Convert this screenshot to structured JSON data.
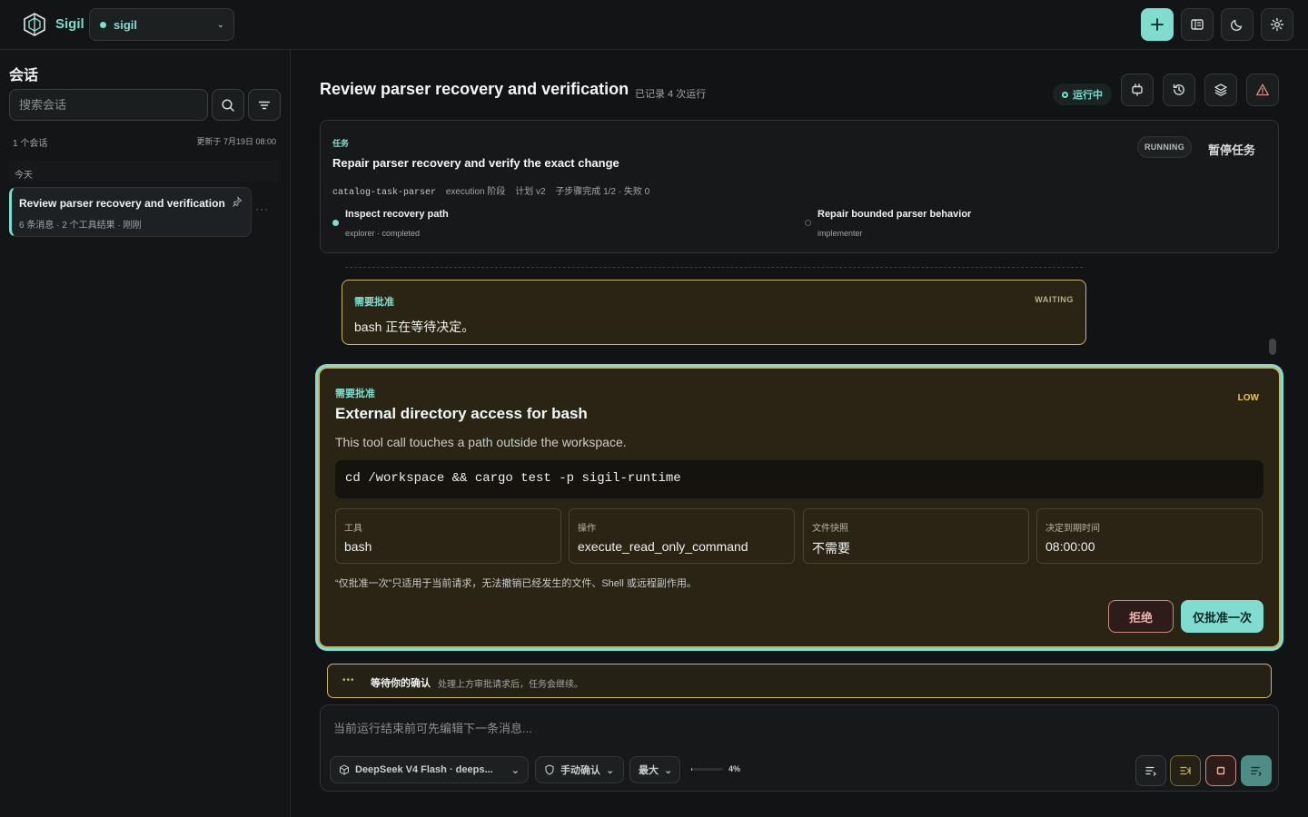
{
  "app": {
    "name": "Sigil",
    "workspace": "sigil"
  },
  "colors": {
    "accent": "#7fdccf",
    "warning_border": "#c9b46a",
    "danger": "#f0b0a8"
  },
  "toolbar": {
    "icons": [
      "plus-icon",
      "layout-icon",
      "moon-icon",
      "gear-icon"
    ]
  },
  "sidebar": {
    "title": "会话",
    "search_placeholder": "搜索会话",
    "count": "1 个会话",
    "updated": "更新于 7月19日 08:00",
    "group": "今天",
    "items": [
      {
        "title": "Review parser recovery and verification",
        "meta": "6 条消息 · 2 个工具结果 · 刚刚",
        "more": "···"
      }
    ]
  },
  "header": {
    "title": "Review parser recovery and verification",
    "subtitle": "已记录 4 次运行",
    "status": "运行中",
    "icons": [
      "plugin-icon",
      "history-icon",
      "layers-icon",
      "warning-icon"
    ]
  },
  "task": {
    "kicker": "任务",
    "title": "Repair parser recovery and verify the exact change",
    "id": "catalog-task-parser",
    "stage": "execution 阶段",
    "plan": "计划 v2",
    "progress": "子步骤完成 1/2 · 失败 0",
    "state": "RUNNING",
    "pause_label": "暂停任务",
    "steps": [
      {
        "name": "Inspect recovery path",
        "role": "explorer · completed",
        "status": "completed"
      },
      {
        "name": "Repair bounded parser behavior",
        "role": "implementer",
        "status": "pending"
      }
    ]
  },
  "waiting_card": {
    "kicker": "需要批准",
    "state": "WAITING",
    "body": "bash 正在等待决定。"
  },
  "approval": {
    "kicker": "需要批准",
    "level": "LOW",
    "title": "External directory access for bash",
    "description": "This tool call touches a path outside the workspace.",
    "command": "cd /workspace && cargo test -p sigil-runtime",
    "fields": [
      {
        "label": "工具",
        "value": "bash"
      },
      {
        "label": "操作",
        "value": "execute_read_only_command"
      },
      {
        "label": "文件快照",
        "value": "不需要"
      },
      {
        "label": "决定到期时间",
        "value": "08:00:00"
      }
    ],
    "note": "“仅批准一次”只适用于当前请求，无法撤销已经发生的文件、Shell 或远程副作用。",
    "reject_label": "拒绝",
    "approve_label": "仅批准一次"
  },
  "confirm_bar": {
    "title": "等待你的确认",
    "subtitle": "处理上方审批请求后，任务会继续。"
  },
  "composer": {
    "placeholder": "当前运行结束前可先编辑下一条消息...",
    "model": "DeepSeek V4 Flash · deeps...",
    "approval_mode": "手动确认",
    "effort": "最大",
    "context_usage": 0.04,
    "context_usage_label": "4%"
  }
}
